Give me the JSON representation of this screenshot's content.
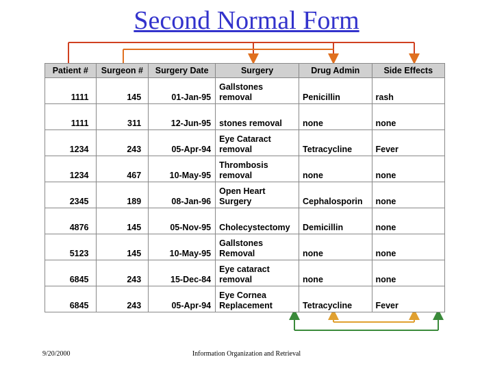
{
  "title": "Second Normal Form",
  "footer": {
    "date": "9/20/2000",
    "name": "Information Organization and Retrieval"
  },
  "table": {
    "headers": [
      "Patient #",
      "Surgeon #",
      "Surgery Date",
      "Surgery",
      "Drug Admin",
      "Side Effects"
    ],
    "rows": [
      {
        "patient": "1111",
        "surgeon": "145",
        "date": "01-Jan-95",
        "surgery": "Gallstones removal",
        "drug": "Penicillin",
        "side": "rash"
      },
      {
        "patient": "1111",
        "surgeon": "311",
        "date": "12-Jun-95",
        "surgery": "stones removal",
        "drug": "none",
        "side": "none"
      },
      {
        "patient": "1234",
        "surgeon": "243",
        "date": "05-Apr-94",
        "surgery": "Eye Cataract removal",
        "drug": "Tetracycline",
        "side": "Fever"
      },
      {
        "patient": "1234",
        "surgeon": "467",
        "date": "10-May-95",
        "surgery": "Thrombosis removal",
        "drug": "none",
        "side": "none"
      },
      {
        "patient": "2345",
        "surgeon": "189",
        "date": "08-Jan-96",
        "surgery": "Open Heart Surgery",
        "drug": "Cephalosporin",
        "side": "none"
      },
      {
        "patient": "4876",
        "surgeon": "145",
        "date": "05-Nov-95",
        "surgery": "Cholecystectomy",
        "drug": "Demicillin",
        "side": "none"
      },
      {
        "patient": "5123",
        "surgeon": "145",
        "date": "10-May-95",
        "surgery": "Gallstones Removal",
        "drug": "none",
        "side": "none"
      },
      {
        "patient": "6845",
        "surgeon": "243",
        "date": "15-Dec-84",
        "surgery": "Eye cataract removal",
        "drug": "none",
        "side": "none"
      },
      {
        "patient": "6845",
        "surgeon": "243",
        "date": "05-Apr-94",
        "surgery": "Eye Cornea Replacement",
        "drug": "Tetracycline",
        "side": "Fever"
      }
    ]
  },
  "arrows": {
    "top": {
      "color": "#e07020"
    },
    "bottom": {
      "color": "#e0a030"
    },
    "bottom2": {
      "color": "#3a8a3a"
    }
  }
}
